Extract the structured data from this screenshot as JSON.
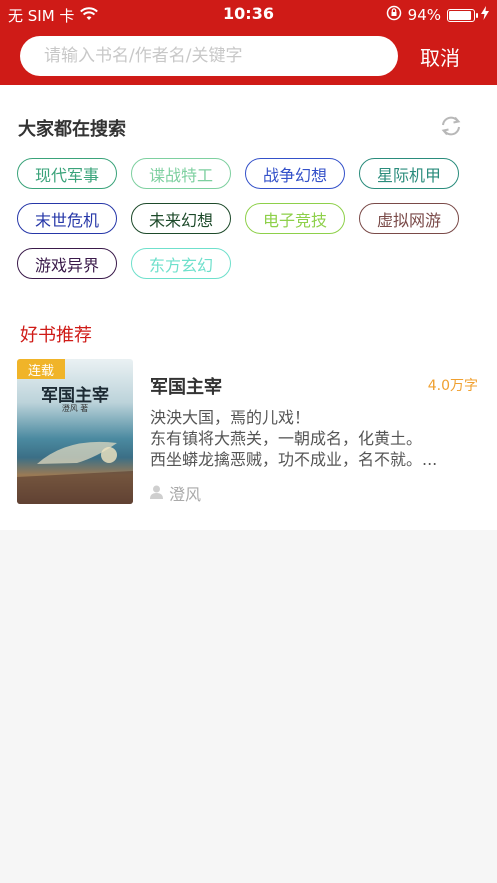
{
  "status_bar": {
    "carrier": "无 SIM 卡",
    "time": "10:36",
    "battery": "94%"
  },
  "search": {
    "placeholder": "请输入书名/作者名/关键字",
    "cancel_label": "取消"
  },
  "hot_section": {
    "title": "大家都在搜索",
    "tags": [
      {
        "label": "现代军事",
        "color": "#3aa37a"
      },
      {
        "label": "谍战特工",
        "color": "#7ed0a0"
      },
      {
        "label": "战争幻想",
        "color": "#3451c9"
      },
      {
        "label": "星际机甲",
        "color": "#2a8c7c"
      },
      {
        "label": "末世危机",
        "color": "#2637a8"
      },
      {
        "label": "未来幻想",
        "color": "#1d4a2a"
      },
      {
        "label": "电子竞技",
        "color": "#8ed04a"
      },
      {
        "label": "虚拟网游",
        "color": "#7a4a48"
      },
      {
        "label": "游戏异界",
        "color": "#3a1a4a"
      },
      {
        "label": "东方玄幻",
        "color": "#6fe0cc"
      }
    ]
  },
  "recommend": {
    "title": "好书推荐",
    "books": [
      {
        "badge": "连载",
        "cover_title": "军国主宰",
        "cover_author": "澄风 著",
        "name": "军国主宰",
        "words": "4.0万字",
        "desc_lines": [
          "泱泱大国，焉的儿戏！",
          "东有镇将大燕关，一朝成名，化黄土。",
          "西坐蟒龙擒恶贼，功不成业，名不就。..."
        ],
        "author": "澄风"
      }
    ]
  }
}
